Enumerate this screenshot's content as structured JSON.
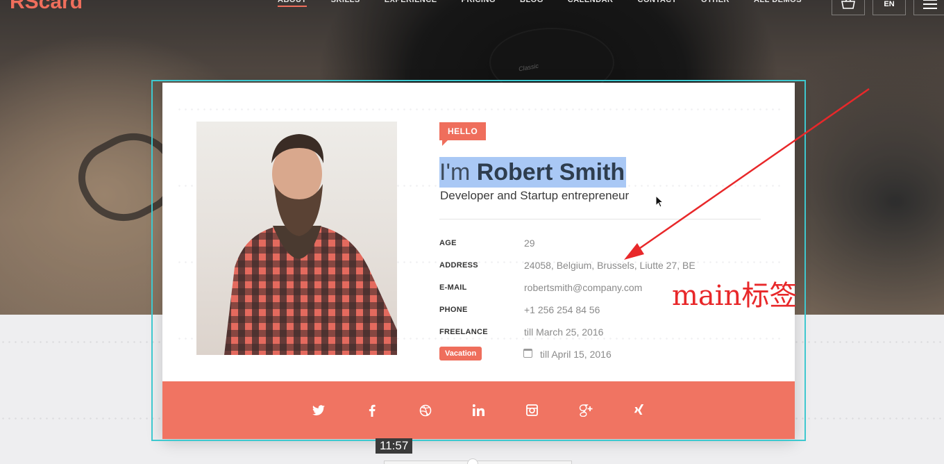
{
  "brand": {
    "logo": "RScard",
    "accent": "#ef6e5c"
  },
  "nav": {
    "items": [
      "ABOUT",
      "SKILLS",
      "EXPERIENCE",
      "PRICING",
      "BLOG",
      "CALENDAR",
      "CONTACT",
      "OTHER",
      "ALL DEMOS"
    ],
    "active": "ABOUT",
    "lang": "EN"
  },
  "card": {
    "badge": "HELLO",
    "name_prefix": "I'm",
    "name": "Robert Smith",
    "role": "Developer and Startup entrepreneur",
    "info": [
      {
        "label": "AGE",
        "value": "29"
      },
      {
        "label": "ADDRESS",
        "value": "24058, Belgium, Brussels, Liutte 27, BE"
      },
      {
        "label": "E-MAIL",
        "value": "robertsmith@company.com"
      },
      {
        "label": "PHONE",
        "value": "+1 256 254 84 56"
      },
      {
        "label": "FREELANCE",
        "value": "till March 25, 2016"
      }
    ],
    "vacation": {
      "label": "Vacation",
      "value": "till April 15, 2016"
    },
    "social_icons": [
      "twitter-icon",
      "facebook-icon",
      "dribbble-icon",
      "linkedin-icon",
      "instagram-icon",
      "google-plus-icon",
      "xing-icon"
    ],
    "footer_color": "#f07462"
  },
  "annotation": {
    "text": "main标签",
    "color": "#e8282a",
    "box_color": "#3ec8cf"
  },
  "video": {
    "timestamp": "11:57"
  }
}
